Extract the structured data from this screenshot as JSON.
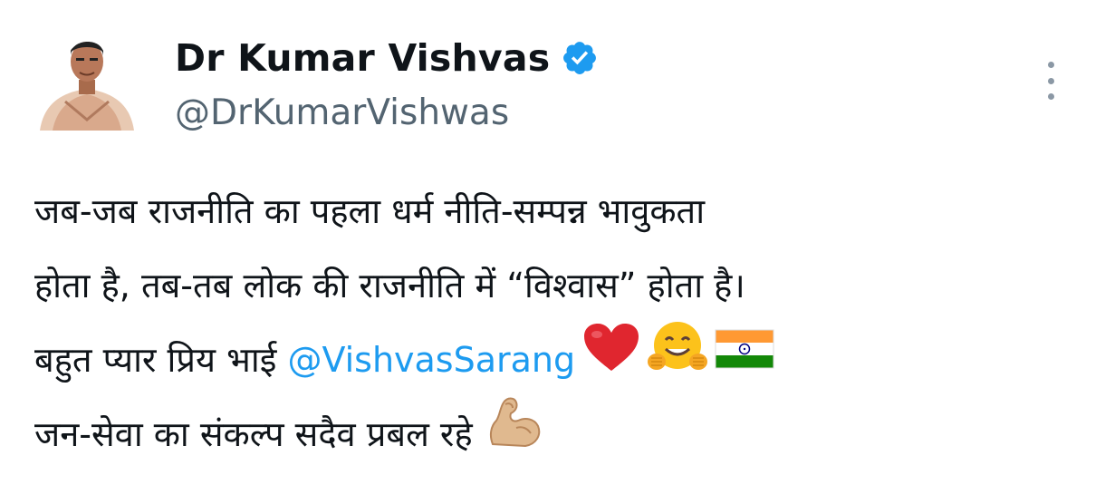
{
  "author": {
    "display_name": "Dr Kumar Vishvas",
    "handle": "@DrKumarVishwas",
    "verified": true
  },
  "tweet": {
    "line1": "जब-जब राजनीति का पहला धर्म नीति-सम्पन्न भावुकता",
    "line2": "होता है, तब-तब लोक की राजनीति में “विश्वास” होता है।",
    "line3_prefix": "बहुत प्यार प्रिय भाई ",
    "line3_mention": "@VishvasSarang",
    "line4": "जन-सेवा का संकल्प सदैव प्रबल रहे"
  },
  "icons": {
    "verified": "verified-badge-icon",
    "more": "more-options-icon",
    "heart": "red-heart-emoji",
    "hug": "hugging-face-emoji",
    "flag": "india-flag-emoji",
    "bicep": "flexed-biceps-emoji"
  },
  "colors": {
    "text": "#0f1419",
    "secondary": "#536471",
    "accent": "#1d9bf0"
  }
}
